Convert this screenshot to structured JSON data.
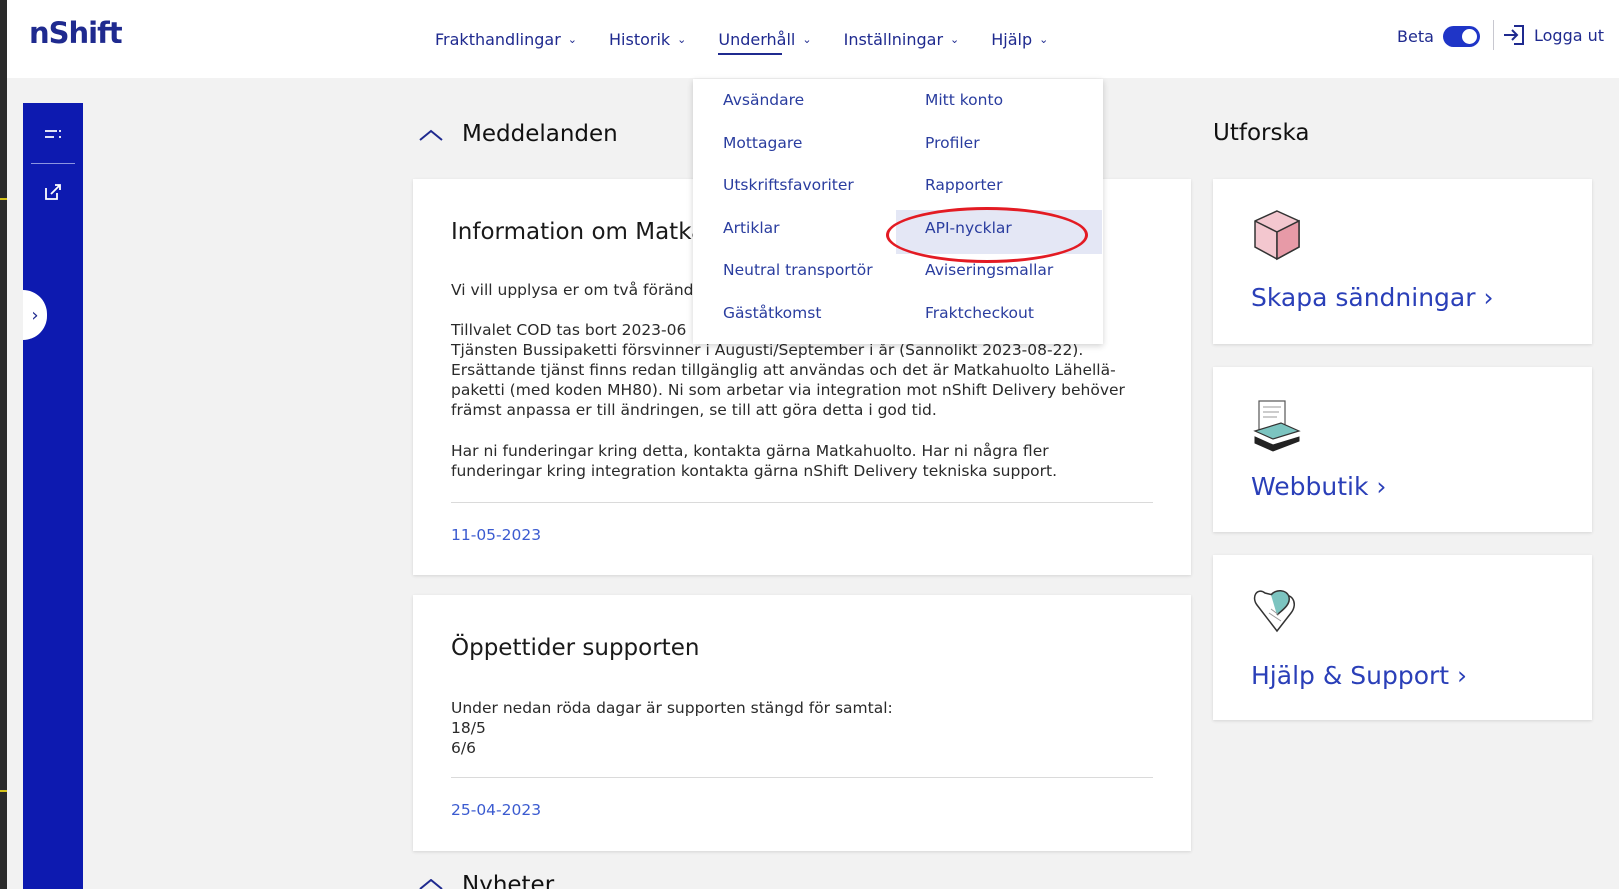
{
  "header": {
    "logo": "nShift",
    "nav": [
      {
        "label": "Frakthandlingar"
      },
      {
        "label": "Historik"
      },
      {
        "label": "Underhåll"
      },
      {
        "label": "Inställningar"
      },
      {
        "label": "Hjälp"
      }
    ],
    "beta_label": "Beta",
    "beta_enabled": true,
    "logout_label": "Logga ut"
  },
  "dropdown": {
    "col1": [
      "Avsändare",
      "Mottagare",
      "Utskriftsfavoriter",
      "Artiklar",
      "Neutral transportör",
      "Gäståtkomst"
    ],
    "col2": [
      "Mitt konto",
      "Profiler",
      "Rapporter",
      "API-nycklar",
      "Aviseringsmallar",
      "Fraktcheckout"
    ],
    "highlighted": "API-nycklar"
  },
  "messages": {
    "title": "Meddelanden",
    "cards": [
      {
        "title": "Information om Matka",
        "paragraph1": "Vi vill upplysa er om två föränd",
        "line1": "Tillvalet COD tas bort 2023-06",
        "paragraph2": "Tjänsten Bussipaketti försvinner i Augusti/September i år (Sannolikt 2023-08-22).\nErsättande tjänst finns redan tillgänglig att användas och det är Matkahuolto Lähellä-\npaketti (med koden MH80). Ni som arbetar via integration mot nShift Delivery behöver\nfrämst anpassa er till ändringen, se till att göra detta i god tid.",
        "paragraph3": "Har ni funderingar kring detta, kontakta gärna Matkahuolto. Har ni några fler\nfunderingar kring integration kontakta gärna nShift Delivery tekniska support.",
        "date": "11-05-2023"
      },
      {
        "title": "Öppettider supporten",
        "body": "Under nedan röda dagar är supporten stängd för samtal:\n18/5\n6/6",
        "date": "25-04-2023"
      }
    ],
    "next_section": "Nyheter"
  },
  "explore": {
    "title": "Utforska",
    "cards": [
      {
        "label": "Skapa sändningar ›",
        "icon": "package-box-icon"
      },
      {
        "label": "Webbutik ›",
        "icon": "laptop-shop-icon"
      },
      {
        "label": "Hjälp & Support ›",
        "icon": "heart-hand-icon"
      }
    ]
  },
  "colors": {
    "brand": "#1f2a8f",
    "sidebar": "#0d1ab0",
    "link": "#2a3fb8",
    "highlight_oval": "#e31b23"
  }
}
